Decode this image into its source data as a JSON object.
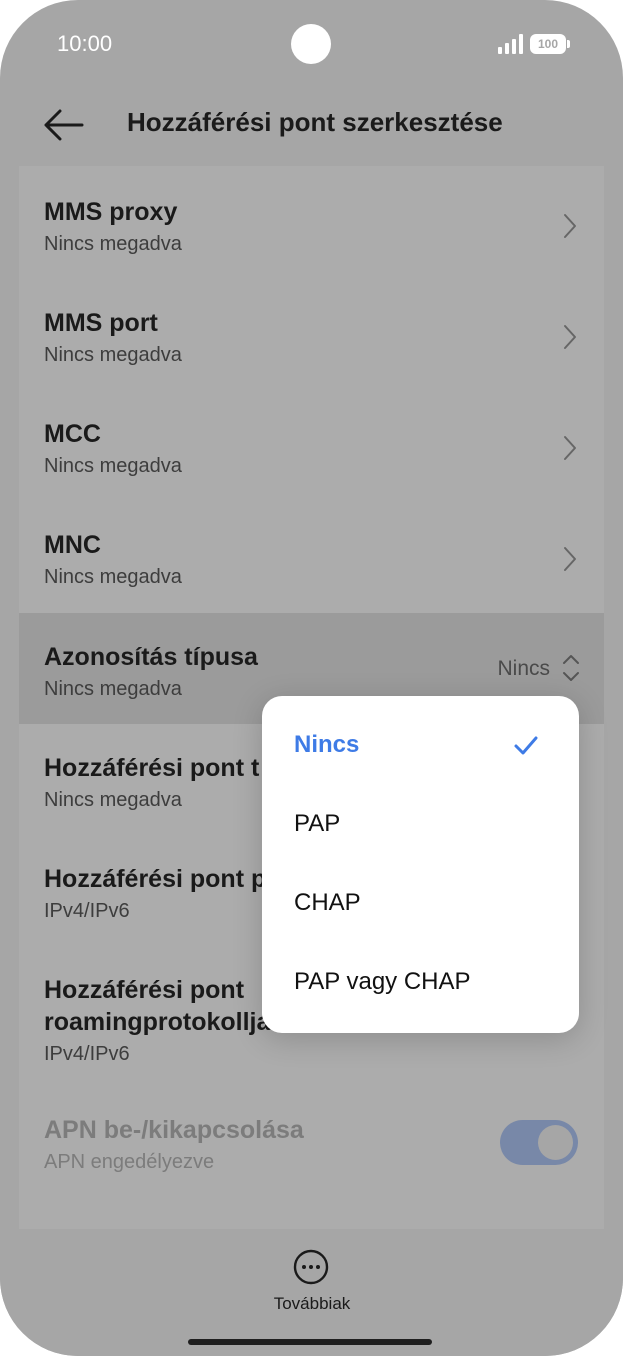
{
  "status": {
    "time": "10:00",
    "battery": "100"
  },
  "header": {
    "title": "Hozzáférési pont szerkesztése"
  },
  "rows": [
    {
      "title": "MMS proxy",
      "sub": "Nincs megadva"
    },
    {
      "title": "MMS port",
      "sub": "Nincs megadva"
    },
    {
      "title": "MCC",
      "sub": "Nincs megadva"
    },
    {
      "title": "MNC",
      "sub": "Nincs megadva"
    },
    {
      "title": "Azonosítás típusa",
      "sub": "Nincs megadva",
      "value": "Nincs"
    },
    {
      "title": "Hozzáférési pont t",
      "sub": "Nincs megadva"
    },
    {
      "title": "Hozzáférési pont p",
      "sub": "IPv4/IPv6"
    },
    {
      "title1": "Hozzáférési pont",
      "title2": "roamingprotokollja",
      "sub": "IPv4/IPv6"
    },
    {
      "title": "APN be-/kikapcsolása",
      "sub": "APN engedélyezve",
      "toggle_on": true
    }
  ],
  "popup": {
    "options": [
      {
        "label": "Nincs",
        "selected": true
      },
      {
        "label": "PAP"
      },
      {
        "label": "CHAP"
      },
      {
        "label": "PAP vagy CHAP"
      }
    ]
  },
  "bottom": {
    "more_label": "Továbbiak"
  },
  "colors": {
    "accent": "#3e7be6",
    "toggle": "#7888a8"
  }
}
